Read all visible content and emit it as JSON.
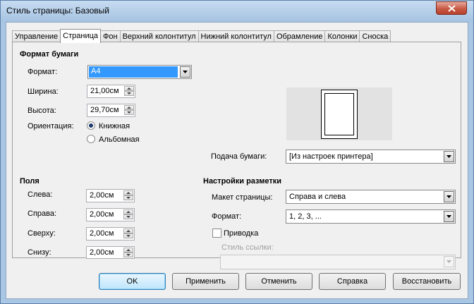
{
  "window": {
    "title": "Стиль страницы: Базовый"
  },
  "tabs": [
    {
      "label": "Управление"
    },
    {
      "label": "Страница"
    },
    {
      "label": "Фон"
    },
    {
      "label": "Верхний колонтитул"
    },
    {
      "label": "Нижний колонтитул"
    },
    {
      "label": "Обрамление"
    },
    {
      "label": "Колонки"
    },
    {
      "label": "Сноска"
    }
  ],
  "paper": {
    "title": "Формат бумаги",
    "format_label": "Формат:",
    "format_value": "A4",
    "width_label": "Ширина:",
    "width_value": "21,00см",
    "height_label": "Высота:",
    "height_value": "29,70см",
    "orientation_label": "Ориентация:",
    "portrait_label": "Книжная",
    "landscape_label": "Альбомная",
    "tray_label": "Подача бумаги:",
    "tray_value": "[Из настроек принтера]"
  },
  "margins": {
    "title": "Поля",
    "left_label": "Слева:",
    "left_value": "2,00см",
    "right_label": "Справа:",
    "right_value": "2,00см",
    "top_label": "Сверху:",
    "top_value": "2,00см",
    "bottom_label": "Снизу:",
    "bottom_value": "2,00см"
  },
  "layout": {
    "title": "Настройки разметки",
    "page_layout_label": "Макет страницы:",
    "page_layout_value": "Справа и слева",
    "format_label": "Формат:",
    "format_value": "1, 2, 3, ...",
    "register_label": "Приводка",
    "ref_style_label": "Стиль ссылки:"
  },
  "buttons": {
    "ok": "OK",
    "apply": "Применить",
    "cancel": "Отменить",
    "help": "Справка",
    "reset": "Восстановить"
  }
}
